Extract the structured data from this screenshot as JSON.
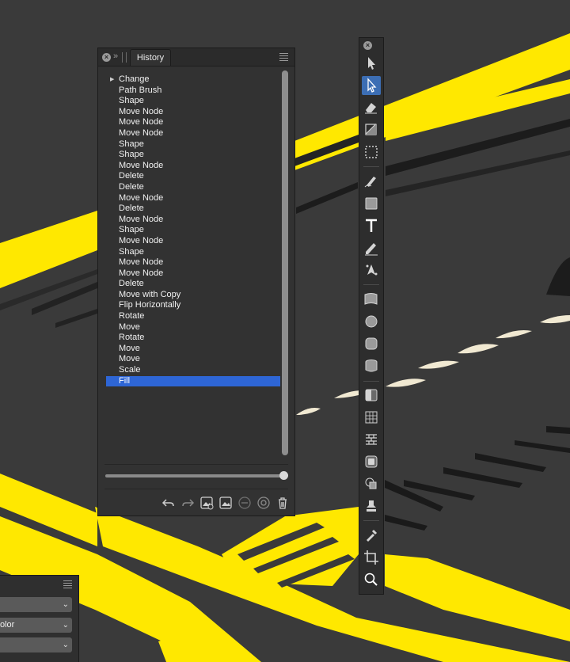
{
  "history": {
    "tab_label": "History",
    "items": [
      {
        "label": "Change",
        "expandable": true
      },
      {
        "label": "Path Brush"
      },
      {
        "label": "Shape"
      },
      {
        "label": "Move Node"
      },
      {
        "label": "Move Node"
      },
      {
        "label": "Move Node"
      },
      {
        "label": "Shape"
      },
      {
        "label": "Shape"
      },
      {
        "label": "Move Node"
      },
      {
        "label": "Delete"
      },
      {
        "label": "Delete"
      },
      {
        "label": "Move Node"
      },
      {
        "label": "Delete"
      },
      {
        "label": "Move Node"
      },
      {
        "label": "Shape"
      },
      {
        "label": "Move Node"
      },
      {
        "label": "Shape"
      },
      {
        "label": "Move Node"
      },
      {
        "label": "Move Node"
      },
      {
        "label": "Delete"
      },
      {
        "label": "Move with Copy"
      },
      {
        "label": "Flip Horizontally"
      },
      {
        "label": "Rotate"
      },
      {
        "label": "Move"
      },
      {
        "label": "Rotate"
      },
      {
        "label": "Move"
      },
      {
        "label": "Move"
      },
      {
        "label": "Scale"
      },
      {
        "label": "Fill",
        "selected": true
      }
    ],
    "timeline_position": 1.0,
    "footer_buttons": [
      "undo-icon",
      "redo-icon",
      "snapshot-add-icon",
      "snapshot-icon",
      "minus-circle-icon",
      "refresh-circle-icon",
      "trash-icon"
    ]
  },
  "tools": {
    "items": [
      "move-tool-icon",
      "node-tool-icon",
      "eraser-tool-icon",
      "transparency-tool-icon",
      "marquee-selection-icon",
      "paint-brush-tool-icon",
      "rectangle-tool-icon",
      "text-tool-icon",
      "pencil-tool-icon",
      "pen-tool-icon",
      "mesh-warp-tool-icon",
      "ellipse-tool-icon",
      "rounded-rectangle-tool-icon",
      "cylinder-tool-icon",
      "gradient-tool-icon",
      "grid-warp-tool-icon",
      "brick-pattern-tool-icon",
      "square-button-tool-icon",
      "shape-builder-tool-icon",
      "stamp-tool-icon",
      "color-picker-tool-icon",
      "crop-tool-icon",
      "zoom-tool-icon"
    ],
    "active": "node-tool-icon"
  },
  "bottom_panel": {
    "selects": [
      {
        "value": ""
      },
      {
        "value": "olor"
      },
      {
        "value": ""
      }
    ]
  },
  "colors": {
    "canvas_bg": "#3a3a3a",
    "accent_yellow": "#ffe800",
    "selection_blue": "#2e66d6",
    "cream": "#f1e9d2"
  }
}
